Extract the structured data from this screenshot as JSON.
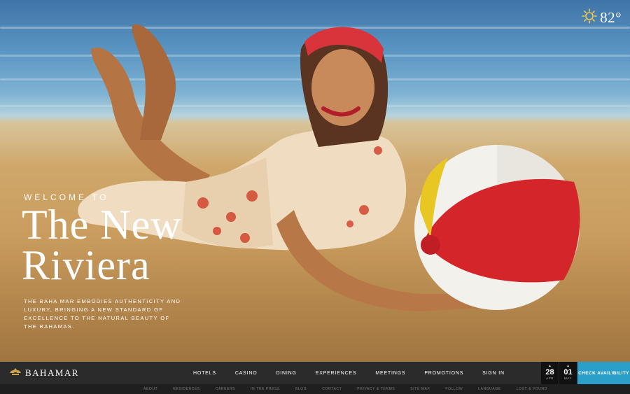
{
  "weather": {
    "temperature": "82°",
    "icon": "sun-icon"
  },
  "hero": {
    "eyebrow": "WELCOME TO",
    "headline_line1": "The New",
    "headline_line2": "Riviera",
    "description": "THE BAHA MAR EMBODIES AUTHENTICITY AND LUXURY, BRINGING A NEW STANDARD OF EXCELLENCE TO THE NATURAL BEAUTY OF THE BAHAMAS."
  },
  "brand": {
    "name": "BAHAMAR",
    "icon": "palm-crest-icon"
  },
  "main_nav": [
    "HOTELS",
    "CASINO",
    "DINING",
    "EXPERIENCES",
    "MEETINGS",
    "PROMOTIONS",
    "SIGN IN"
  ],
  "booking": {
    "checkin": {
      "day": "28",
      "month": "APR"
    },
    "checkout": {
      "day": "01",
      "month": "MAY"
    },
    "cta": "CHECK AVAILIBILITY"
  },
  "footer_nav": [
    "ABOUT",
    "RESIDENCES",
    "CAREERS",
    "IN THE PRESS",
    "BLOG",
    "CONTACT",
    "PRIVACY & TERMS",
    "SITE MAP",
    "FOLLOW",
    "LANGUAGE",
    "LOST & FOUND"
  ],
  "colors": {
    "accent": "#2aa0c9",
    "bar": "#2b2b2b",
    "footer": "#1f1f1f",
    "date_box": "#111111"
  }
}
